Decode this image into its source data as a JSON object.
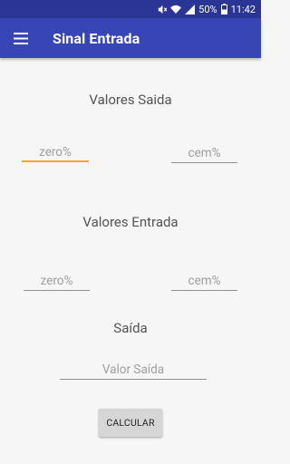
{
  "statusbar": {
    "battery": "50%",
    "time": "11:42"
  },
  "appbar": {
    "title": "Sinal Entrada",
    "menu_icon": "hamburger-menu-icon"
  },
  "saida_section": {
    "title": "Valores Saida",
    "zero_placeholder": "zero%",
    "cem_placeholder": "cem%"
  },
  "entrada_section": {
    "title": "Valores Entrada",
    "zero_placeholder": "zero%",
    "cem_placeholder": "cem%"
  },
  "output_section": {
    "title": "Saída",
    "placeholder": "Valor Saída"
  },
  "calc_button": {
    "label": "CALCULAR"
  },
  "colors": {
    "status_bar": "#2b3595",
    "app_bar": "#3845b5",
    "focus_accent": "#f5a623",
    "background": "#f6f6f6"
  }
}
